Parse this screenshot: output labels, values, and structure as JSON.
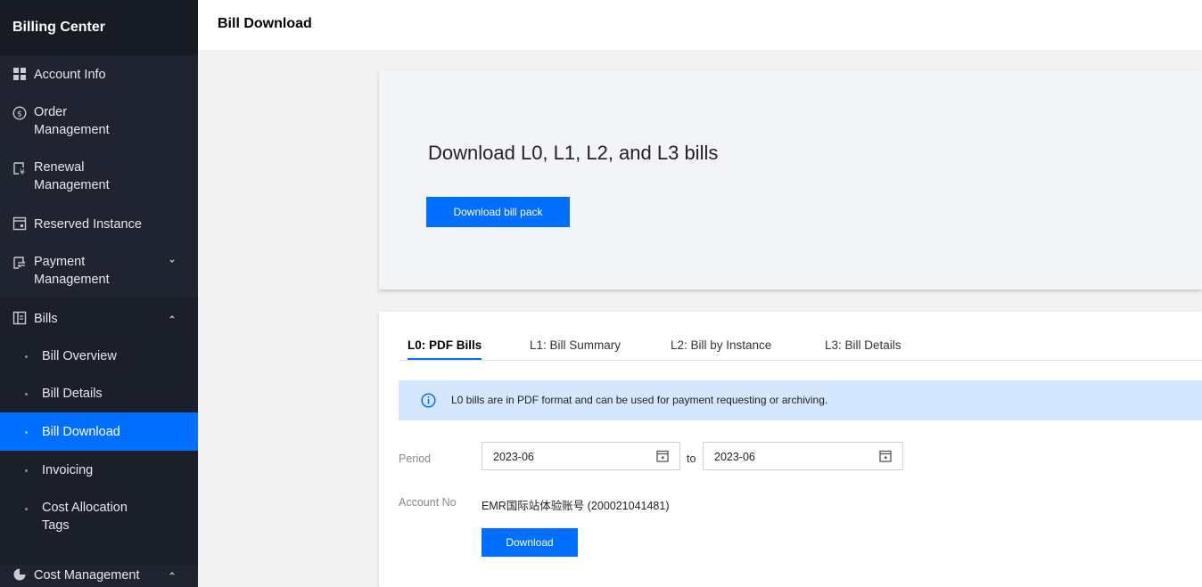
{
  "sidebar": {
    "title": "Billing Center",
    "items": {
      "account_info": {
        "label": "Account Info",
        "icon": "grid-icon"
      },
      "order_mgmt": {
        "label": "Order\nManagement",
        "icon": "currency-circle-icon"
      },
      "renewal_mgmt": {
        "label": "Renewal\nManagement",
        "icon": "renewal-doc-icon"
      },
      "reserved_instance": {
        "label": "Reserved Instance",
        "icon": "calendar-box-icon"
      },
      "payment_mgmt": {
        "label": "Payment\nManagement",
        "icon": "payment-transfer-icon"
      },
      "bills": {
        "label": "Bills",
        "icon": "bills-doc-icon"
      },
      "cost_mgmt": {
        "label": "Cost Management",
        "icon": "pie-chart-icon"
      }
    },
    "bills_sub": {
      "overview": "Bill Overview",
      "details": "Bill Details",
      "download": "Bill Download",
      "invoicing": "Invoicing",
      "cost_tags": "Cost Allocation\nTags"
    }
  },
  "header": {
    "title": "Bill Download"
  },
  "hero": {
    "title": "Download L0, L1, L2, and L3 bills",
    "button": "Download bill pack"
  },
  "tabs": [
    "L0: PDF Bills",
    "L1: Bill Summary",
    "L2: Bill by Instance",
    "L3: Bill Details"
  ],
  "active_tab": "L0: PDF Bills",
  "info": {
    "text": "L0 bills are in PDF format and can be used for payment requesting or archiving."
  },
  "form": {
    "period_label": "Period",
    "period_from": "2023-06",
    "to": "to",
    "period_to": "2023-06",
    "account_label": "Account No",
    "account_value": "EMR国际站体验账号 (200021041481)",
    "download_button": "Download"
  },
  "colors": {
    "primary": "#006eff",
    "sidebar_bg": "#1f2430",
    "info_bg": "#d5e7fe"
  }
}
